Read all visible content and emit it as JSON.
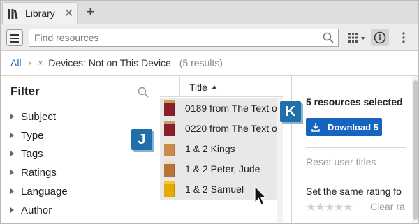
{
  "tab": {
    "label": "Library",
    "close_glyph": "✕",
    "new_glyph": "+"
  },
  "toolbar": {
    "search_placeholder": "Find resources"
  },
  "breadcrumb": {
    "root": "All",
    "separator": "›",
    "remove_glyph": "×",
    "filter_label": "Devices: Not on This Device",
    "result_count": "(5 results)"
  },
  "filter": {
    "title": "Filter",
    "facets": [
      "Subject",
      "Type",
      "Tags",
      "Ratings",
      "Language",
      "Author"
    ]
  },
  "results": {
    "column_title": "Title",
    "rows": [
      {
        "title": "0189 from The Text o",
        "cover_color": "#8b1e2a",
        "cover_accent": "#c6a15a"
      },
      {
        "title": "0220 from The Text o",
        "cover_color": "#8b1e2a",
        "cover_accent": "#c6a15a"
      },
      {
        "title": "1 & 2 Kings",
        "cover_color": "#c98b4a",
        "cover_accent": "#f2e4cf"
      },
      {
        "title": "1 & 2 Peter, Jude",
        "cover_color": "#b8733a",
        "cover_accent": "#f0dcc0"
      },
      {
        "title": "1 & 2 Samuel",
        "cover_color": "#e7a800",
        "cover_accent": "#f3c53a"
      }
    ]
  },
  "callouts": {
    "j": "J",
    "k": "K"
  },
  "info": {
    "selected_count": "5 resources selected",
    "download_label": "Download 5",
    "reset_titles": "Reset user titles",
    "same_rating": "Set the same rating fo",
    "stars": "★★★★★",
    "clear_rating": "Clear ra"
  },
  "colors": {
    "accent": "#1565c0",
    "link": "#1b66b8",
    "callout": "#1f6fa8"
  }
}
